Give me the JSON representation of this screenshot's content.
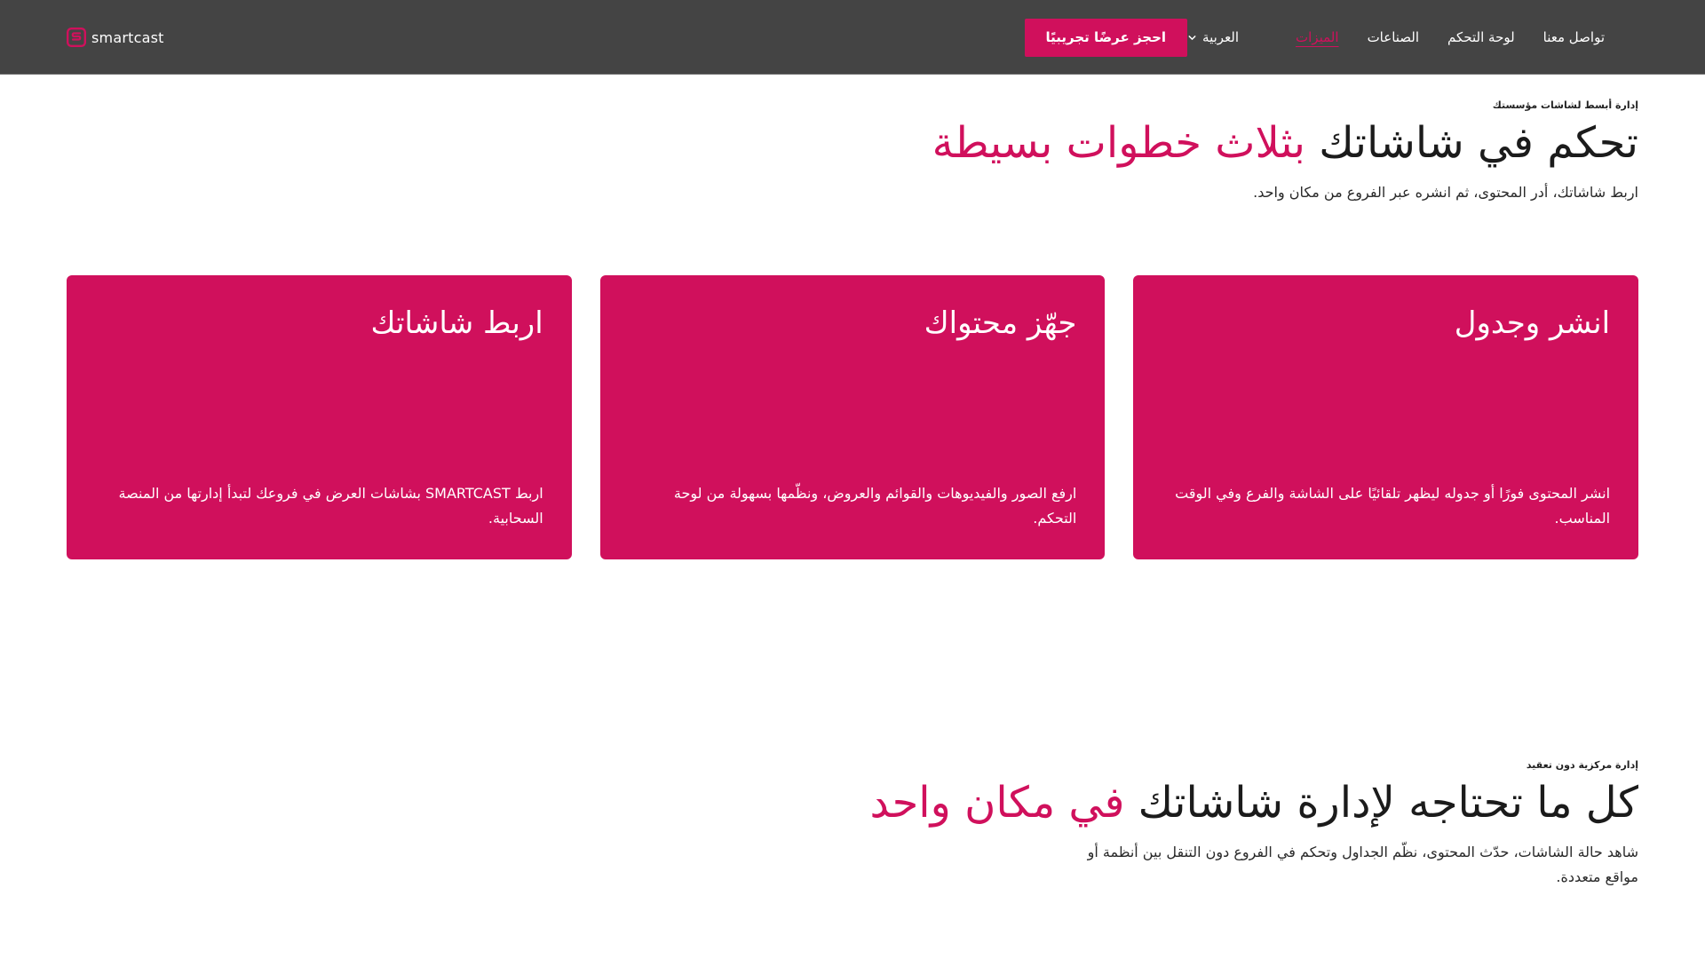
{
  "header": {
    "logo_text": "smartcast",
    "cta_label": "احجز عرضًا تجريبيًا",
    "language_label": "العربية",
    "nav": [
      {
        "label": "الميزات",
        "active": true
      },
      {
        "label": "الصناعات",
        "active": false
      },
      {
        "label": "لوحة التحكم",
        "active": false
      },
      {
        "label": "تواصل معنا",
        "active": false
      }
    ],
    "colors": {
      "bar": "#444444",
      "accent": "#d0105c"
    }
  },
  "steps_section": {
    "eyebrow": "إدارة أبسط لشاشات مؤسستك",
    "heading_plain": "تحكم في شاشاتك ",
    "heading_accent": "بثلاث خطوات بسيطة",
    "subtext": "اربط شاشاتك، أدر المحتوى، ثم انشره عبر الفروع من مكان واحد.",
    "cards": [
      {
        "title": "اربط شاشاتك",
        "description": "اربط SMARTCAST بشاشات العرض في فروعك لتبدأ إدارتها من المنصة السحابية."
      },
      {
        "title": "جهّز محتواك",
        "description": "ارفع الصور والفيديوهات والقوائم والعروض، ونظّمها بسهولة من لوحة التحكم."
      },
      {
        "title": "انشر وجدول",
        "description": "انشر المحتوى فورًا أو جدوله ليظهر تلقائيًا على الشاشة والفرع وفي الوقت المناسب."
      }
    ]
  },
  "management_section": {
    "eyebrow": "إدارة مركزية دون تعقيد",
    "heading_plain": "كل ما تحتاجه لإدارة شاشاتك ",
    "heading_accent": "في مكان واحد",
    "subtext_line1": "شاهد حالة الشاشات، حدّث المحتوى، نظّم الجداول وتحكم في الفروع دون التنقل بين أنظمة أو",
    "subtext_line2": "مواقع متعددة."
  }
}
